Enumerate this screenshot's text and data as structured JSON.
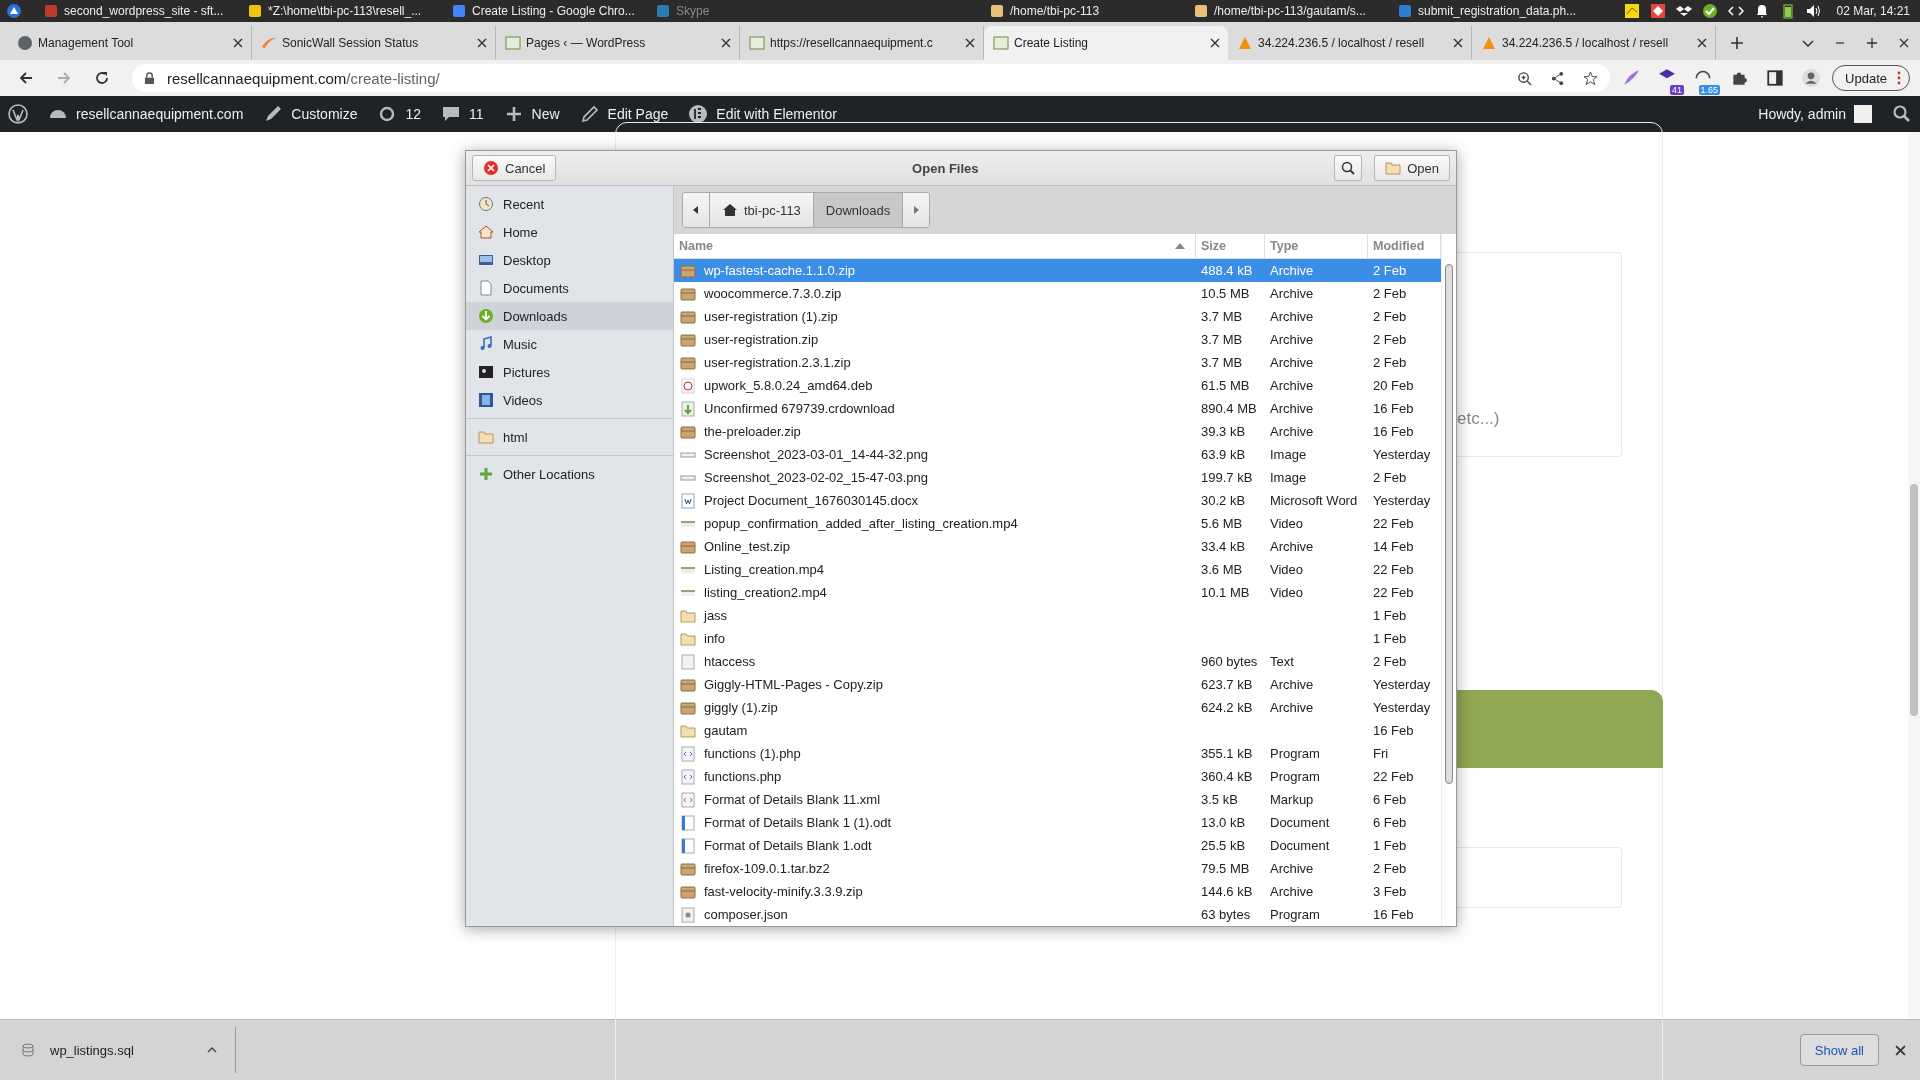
{
  "taskbar": {
    "items": [
      {
        "label": "second_wordpress_site - sft...",
        "dimmed": false
      },
      {
        "label": "*Z:\\home\\tbi-pc-113\\resell_...",
        "dimmed": false
      },
      {
        "label": "Create Listing - Google Chro...",
        "dimmed": false
      },
      {
        "label": "Skype",
        "dimmed": true
      },
      {
        "label": "/home/tbi-pc-113",
        "dimmed": false
      },
      {
        "label": "/home/tbi-pc-113/gautam/s...",
        "dimmed": false
      },
      {
        "label": "submit_registration_data.ph...",
        "dimmed": false
      }
    ],
    "clock": "02 Mar, 14:21"
  },
  "tabs": [
    {
      "label": "Management Tool",
      "selected": false
    },
    {
      "label": "SonicWall Session Status",
      "selected": false
    },
    {
      "label": "Pages ‹ — WordPress",
      "selected": false
    },
    {
      "label": "https://resellcannaequipment.c",
      "selected": false
    },
    {
      "label": "Create Listing",
      "selected": true
    },
    {
      "label": "34.224.236.5 / localhost / resell",
      "selected": false
    },
    {
      "label": "34.224.236.5 / localhost / resell",
      "selected": false
    }
  ],
  "address_bar": {
    "host": "resellcannaequipment.com",
    "path": "/create-listing/"
  },
  "extensions": {
    "badge_1": "41",
    "badge_2": "1.65"
  },
  "update_button": "Update",
  "admin_bar": {
    "site": "resellcannaequipment.com",
    "customize": "Customize",
    "updates": "12",
    "comments": "11",
    "new": "New",
    "edit_page": "Edit Page",
    "elementor": "Edit with Elementor",
    "greeting": "Howdy, admin"
  },
  "page": {
    "field_text": "etc...)"
  },
  "dialog": {
    "title": "Open Files",
    "cancel": "Cancel",
    "open": "Open",
    "sidebar": {
      "places": [
        {
          "label": "Recent",
          "selected": false
        },
        {
          "label": "Home",
          "selected": false
        },
        {
          "label": "Desktop",
          "selected": false
        },
        {
          "label": "Documents",
          "selected": false
        },
        {
          "label": "Downloads",
          "selected": true
        },
        {
          "label": "Music",
          "selected": false
        },
        {
          "label": "Pictures",
          "selected": false
        },
        {
          "label": "Videos",
          "selected": false
        }
      ],
      "bookmarks": [
        {
          "label": "html",
          "selected": false
        }
      ],
      "other": [
        {
          "label": "Other Locations",
          "selected": false
        }
      ]
    },
    "path": [
      {
        "label": "tbi-pc-113",
        "selected": false
      },
      {
        "label": "Downloads",
        "selected": true
      }
    ],
    "columns": [
      "Name",
      "Size",
      "Type",
      "Modified"
    ],
    "rows": [
      {
        "kind": "archive",
        "name": "wp-fastest-cache.1.1.0.zip",
        "size": "488.4 kB",
        "type": "Archive",
        "modified": "2 Feb",
        "selected": true
      },
      {
        "kind": "archive",
        "name": "woocommerce.7.3.0.zip",
        "size": "10.5 MB",
        "type": "Archive",
        "modified": "2 Feb",
        "selected": false
      },
      {
        "kind": "archive",
        "name": "user-registration (1).zip",
        "size": "3.7 MB",
        "type": "Archive",
        "modified": "2 Feb",
        "selected": false
      },
      {
        "kind": "archive",
        "name": "user-registration.zip",
        "size": "3.7 MB",
        "type": "Archive",
        "modified": "2 Feb",
        "selected": false
      },
      {
        "kind": "archive",
        "name": "user-registration.2.3.1.zip",
        "size": "3.7 MB",
        "type": "Archive",
        "modified": "2 Feb",
        "selected": false
      },
      {
        "kind": "package",
        "name": "upwork_5.8.0.24_amd64.deb",
        "size": "61.5 MB",
        "type": "Archive",
        "modified": "20 Feb",
        "selected": false
      },
      {
        "kind": "download",
        "name": "Unconfirmed 679739.crdownload",
        "size": "890.4 MB",
        "type": "Archive",
        "modified": "16 Feb",
        "selected": false
      },
      {
        "kind": "archive",
        "name": "the-preloader.zip",
        "size": "39.3 kB",
        "type": "Archive",
        "modified": "16 Feb",
        "selected": false
      },
      {
        "kind": "image",
        "name": "Screenshot_2023-03-01_14-44-32.png",
        "size": "63.9 kB",
        "type": "Image",
        "modified": "Yesterday",
        "selected": false
      },
      {
        "kind": "image",
        "name": "Screenshot_2023-02-02_15-47-03.png",
        "size": "199.7 kB",
        "type": "Image",
        "modified": "2 Feb",
        "selected": false
      },
      {
        "kind": "word",
        "name": "Project Document_1676030145.docx",
        "size": "30.2 kB",
        "type": "Microsoft Word",
        "modified": "Yesterday",
        "selected": false
      },
      {
        "kind": "video",
        "name": "popup_confirmation_added_after_listing_creation.mp4",
        "size": "5.6 MB",
        "type": "Video",
        "modified": "22 Feb",
        "selected": false
      },
      {
        "kind": "archive",
        "name": "Online_test.zip",
        "size": "33.4 kB",
        "type": "Archive",
        "modified": "14 Feb",
        "selected": false
      },
      {
        "kind": "video",
        "name": "Listing_creation.mp4",
        "size": "3.6 MB",
        "type": "Video",
        "modified": "22 Feb",
        "selected": false
      },
      {
        "kind": "video",
        "name": "listing_creation2.mp4",
        "size": "10.1 MB",
        "type": "Video",
        "modified": "22 Feb",
        "selected": false
      },
      {
        "kind": "folder",
        "name": "jass",
        "modified": "1 Feb",
        "selected": false
      },
      {
        "kind": "folder",
        "name": "info",
        "modified": "1 Feb",
        "selected": false
      },
      {
        "kind": "text",
        "name": "htaccess",
        "size": "960 bytes",
        "type": "Text",
        "modified": "2 Feb",
        "selected": false
      },
      {
        "kind": "archive",
        "name": "Giggly-HTML-Pages - Copy.zip",
        "size": "623.7 kB",
        "type": "Archive",
        "modified": "Yesterday",
        "selected": false
      },
      {
        "kind": "archive",
        "name": "giggly (1).zip",
        "size": "624.2 kB",
        "type": "Archive",
        "modified": "Yesterday",
        "selected": false
      },
      {
        "kind": "folder",
        "name": "gautam",
        "modified": "16 Feb",
        "selected": false
      },
      {
        "kind": "code",
        "name": "functions (1).php",
        "size": "355.1 kB",
        "type": "Program",
        "modified": "Fri",
        "selected": false
      },
      {
        "kind": "code",
        "name": "functions.php",
        "size": "360.4 kB",
        "type": "Program",
        "modified": "22 Feb",
        "selected": false
      },
      {
        "kind": "markup",
        "name": "Format of Details Blank 11.xml",
        "size": "3.5 kB",
        "type": "Markup",
        "modified": "6 Feb",
        "selected": false
      },
      {
        "kind": "document",
        "name": "Format of Details Blank 1 (1).odt",
        "size": "13.0 kB",
        "type": "Document",
        "modified": "6 Feb",
        "selected": false
      },
      {
        "kind": "document",
        "name": "Format of Details Blank 1.odt",
        "size": "25.5 kB",
        "type": "Document",
        "modified": "1 Feb",
        "selected": false
      },
      {
        "kind": "archive",
        "name": "firefox-109.0.1.tar.bz2",
        "size": "79.5 MB",
        "type": "Archive",
        "modified": "2 Feb",
        "selected": false
      },
      {
        "kind": "archive",
        "name": "fast-velocity-minify.3.3.9.zip",
        "size": "144.6 kB",
        "type": "Archive",
        "modified": "3 Feb",
        "selected": false
      },
      {
        "kind": "script",
        "name": "composer.json",
        "size": "63 bytes",
        "type": "Program",
        "modified": "16 Feb",
        "selected": false
      }
    ]
  },
  "download_bar": {
    "file": "wp_listings.sql",
    "show_all": "Show all"
  }
}
